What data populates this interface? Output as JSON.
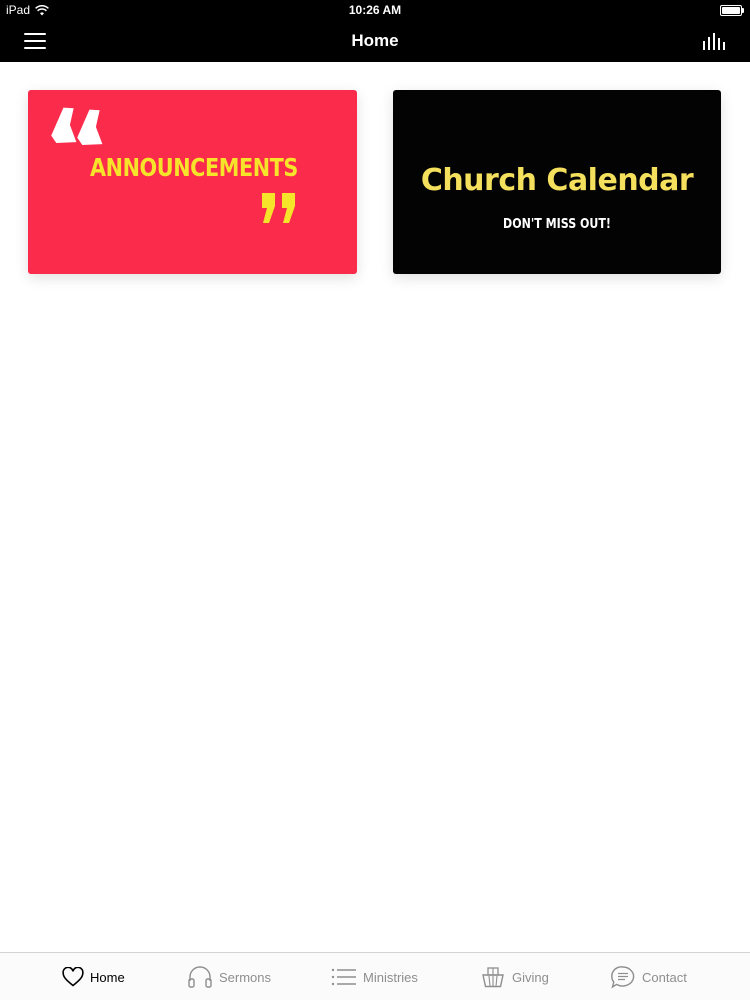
{
  "status_bar": {
    "device": "iPad",
    "time": "10:26 AM",
    "battery_level": 1.0
  },
  "nav": {
    "title": "Home",
    "menu_icon": "hamburger-menu-icon",
    "right_icon": "equalizer-icon"
  },
  "cards": [
    {
      "title": "ANNOUNCEMENTS",
      "background": "#fb2b4b",
      "text_color": "#f6e42a",
      "open_quote_color": "#ffffff",
      "close_quote_color": "#f6e42a"
    },
    {
      "title": "Church Calendar",
      "subtitle": "DON'T MISS OUT!",
      "background": "#040304",
      "text_color": "#f4e05c"
    }
  ],
  "tabs": [
    {
      "label": "Home",
      "icon": "heart-icon",
      "active": true
    },
    {
      "label": "Sermons",
      "icon": "headphones-icon",
      "active": false
    },
    {
      "label": "Ministries",
      "icon": "list-icon",
      "active": false
    },
    {
      "label": "Giving",
      "icon": "gift-basket-icon",
      "active": false
    },
    {
      "label": "Contact",
      "icon": "speech-bubble-icon",
      "active": false
    }
  ]
}
